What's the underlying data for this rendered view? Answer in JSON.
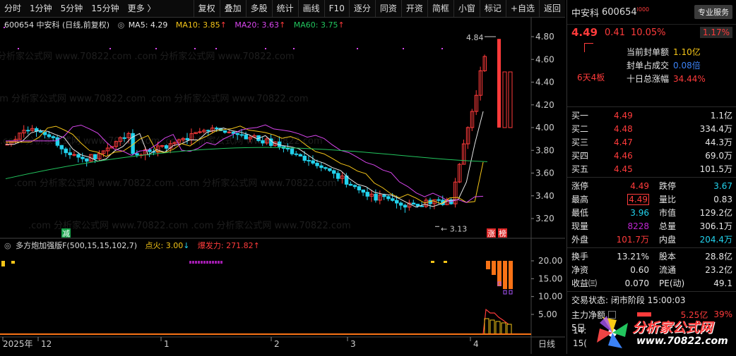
{
  "toolbar": {
    "left_items": [
      "分时",
      "1分钟",
      "5分钟",
      "15分钟",
      "更多 〉"
    ],
    "right_items": [
      "复权",
      "叠加",
      "多股",
      "统计",
      "画线",
      "F10",
      "逐分",
      "同资",
      "开资",
      "简框",
      "小窗",
      "标记",
      "+自选",
      "返回"
    ]
  },
  "chart": {
    "stock_label": "600654 中安科 (日线,前复权)",
    "ma_circle": "◎",
    "ma5": "MA5: 4.29",
    "ma10": "MA10: 3.85",
    "ma20": "MA20: 3.63",
    "ma60": "MA60: 3.75",
    "up_arrow": "↑",
    "colors": {
      "ma5": "#e6e6e6",
      "ma10": "#f5c518",
      "ma20": "#d946ef",
      "ma60": "#22c55e",
      "up": "#ff3b3b",
      "down": "#22d3ee"
    },
    "y_ticks": [
      "4.80",
      "4.60",
      "4.40",
      "4.20",
      "4.00",
      "3.80",
      "3.60",
      "3.40",
      "3.20"
    ],
    "high_label": "4.84",
    "low_label": "3.13",
    "marker_jian": "减",
    "marker_zhang": "涨",
    "marker_bang": "榜",
    "watermark": ".com 分析家公式网 www.70822.com"
  },
  "indicator": {
    "name": "多方炮加强版F(500,15,15,102,7)",
    "dianhuo": "点火: 3.00",
    "down_arrow": "↓",
    "baofa": "爆发力: 271.82",
    "up_arrow": "↑",
    "y_ticks": [
      "20.00",
      "15.00",
      "10.00",
      "5.00"
    ]
  },
  "xaxis": {
    "labels": [
      "2025年",
      "12",
      "1",
      "2",
      "3",
      "4"
    ],
    "period": "日线"
  },
  "panel": {
    "name": "中安科",
    "code": "600654",
    "code_sup": "l000",
    "service": "专业服务",
    "price": "4.49",
    "change": "0.41",
    "pct": "10.05%",
    "service_pct": "1.17%",
    "info": [
      {
        "label": "当前封单额",
        "value": "1.10亿"
      },
      {
        "label": "封单占成交",
        "value": "0.08倍"
      },
      {
        "label": "十日总涨幅",
        "value": "34.44%"
      }
    ],
    "board": "6天4板",
    "bids": [
      {
        "label": "买一",
        "price": "4.49",
        "vol": "1.1亿"
      },
      {
        "label": "买二",
        "price": "4.48",
        "vol": "334.4万"
      },
      {
        "label": "买三",
        "price": "4.47",
        "vol": "44.3万"
      },
      {
        "label": "买四",
        "price": "4.46",
        "vol": "69.0万"
      },
      {
        "label": "买五",
        "price": "4.45",
        "vol": "101.5万"
      }
    ],
    "stats": [
      {
        "l1": "涨停",
        "v1": "4.49",
        "l2": "跌停",
        "v2": "3.67"
      },
      {
        "l1": "最高",
        "v1": "4.49",
        "l2": "量比",
        "v2": "0.83"
      },
      {
        "l1": "最低",
        "v1": "3.96",
        "l2": "市值",
        "v2": "129.2亿"
      },
      {
        "l1": "现量",
        "v1": "8228",
        "l2": "总量",
        "v2": "306.1万"
      },
      {
        "l1": "外盘",
        "v1": "101.7万",
        "l2": "内盘",
        "v2": "204.4万"
      }
    ],
    "stats2": [
      {
        "l1": "换手",
        "v1": "13.21%",
        "l2": "股本",
        "v2": "28.8亿"
      },
      {
        "l1": "净资",
        "v1": "0.60",
        "l2": "流通",
        "v2": "23.2亿"
      },
      {
        "l1": "收益㈢",
        "v1": "0.070",
        "l2": "PE(动)",
        "v2": "49.1"
      }
    ],
    "trade_state": "交易状态: 闭市阶段 15:00:03",
    "main_flow_label": "主力净额",
    "main_flow_value": "5.25亿",
    "main_flow_pct": "39%",
    "day_label": "5日",
    "time1": "14:",
    "time2": "15(",
    "logo_text": "分析家公式网",
    "logo_url": "www.70822.com"
  }
}
